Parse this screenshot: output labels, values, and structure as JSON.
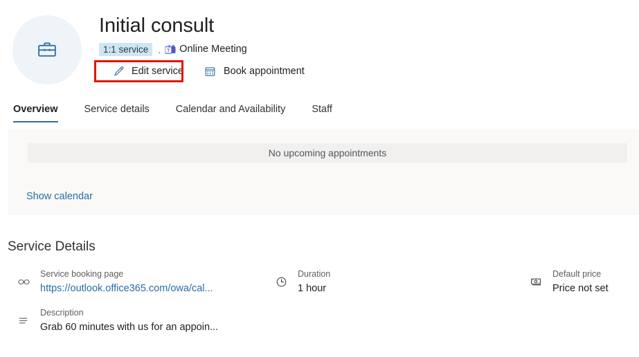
{
  "header": {
    "avatar_icon": "briefcase-icon",
    "title": "Initial consult",
    "badge": "1:1 service",
    "separator": ".",
    "meeting_type": "Online Meeting",
    "meeting_icon": "microsoft-teams-icon",
    "actions": [
      {
        "label": "Edit service",
        "icon": "pencil-icon"
      },
      {
        "label": "Book appointment",
        "icon": "calendar-icon"
      }
    ],
    "highlight_color": "#e51400"
  },
  "tabs": [
    {
      "label": "Overview",
      "active": true
    },
    {
      "label": "Service details",
      "active": false
    },
    {
      "label": "Calendar and Availability",
      "active": false
    },
    {
      "label": "Staff",
      "active": false
    }
  ],
  "appointments": {
    "empty_message": "No upcoming appointments",
    "show_calendar_label": "Show calendar"
  },
  "service_details": {
    "heading": "Service Details",
    "items": [
      {
        "icon": "link-icon",
        "label": "Service booking page",
        "value": "https://outlook.office365.com/owa/cal...",
        "is_link": true
      },
      {
        "icon": "description-lines-icon",
        "label": "Description",
        "value": "Grab 60 minutes with us for an appoin...",
        "is_link": false
      },
      {
        "icon": "clock-icon",
        "label": "Duration",
        "value": "1 hour",
        "is_link": false
      },
      {
        "icon": "money-icon",
        "label": "Default price",
        "value": "Price not set",
        "is_link": false
      }
    ]
  },
  "colors": {
    "accent": "#2b6ca3",
    "badge_bg": "#cfe6f2",
    "panel_bg": "#faf9f8",
    "inner_box_bg": "#f1f0ef",
    "highlight": "#e51400"
  }
}
